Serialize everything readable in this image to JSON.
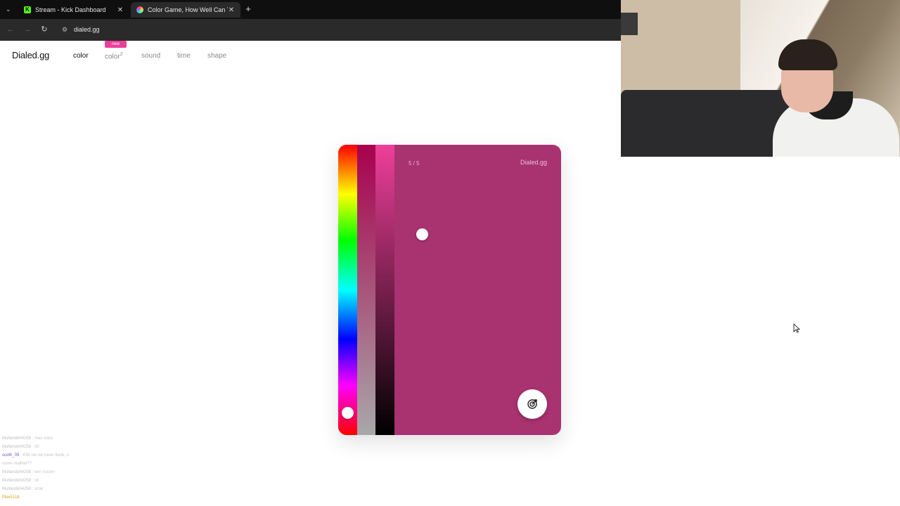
{
  "browser": {
    "tabs": [
      {
        "title": "Stream - Kick Dashboard",
        "favicon": "kick-logo-icon",
        "favicon_text": "K"
      },
      {
        "title": "Color Game, How Well Can You",
        "favicon": "dialed-logo-icon",
        "active": true
      }
    ],
    "url": "dialed.gg"
  },
  "site": {
    "logo": "Dialed.gg",
    "nav": {
      "color": "color",
      "color2": "color",
      "color2_sup": "2",
      "badge": "new",
      "sound": "sound",
      "time": "time",
      "shape": "shape"
    }
  },
  "game": {
    "round": "5 / 5",
    "brand": "Dialed.gg",
    "target_color": "#a93271",
    "sliders": {
      "hue": 0.93,
      "saturation": 0.33,
      "brightness": 0.3
    },
    "submit_icon": "target-icon"
  },
  "colors": {
    "accent": "#ec3f9a",
    "card": "#a93271"
  },
  "chat": [
    {
      "user": "Mullandoh4258",
      "msg": ": mas claro"
    },
    {
      "user": "Mullandoh4258",
      "msg": ": slt"
    },
    {
      "user": "scoth_09",
      "msg": ": Kfdl ow ow tuoer tlanb, o"
    },
    {
      "user": "",
      "msg": "sume mallhel??"
    },
    {
      "user": "Mullandoh4258",
      "msg": ": tem sscum"
    },
    {
      "user": "Mullandoh4258",
      "msg": ": slt"
    },
    {
      "user": "Mullandoh4258",
      "msg": ": slow"
    },
    {
      "user": "Plex5118",
      "msg": ""
    }
  ]
}
